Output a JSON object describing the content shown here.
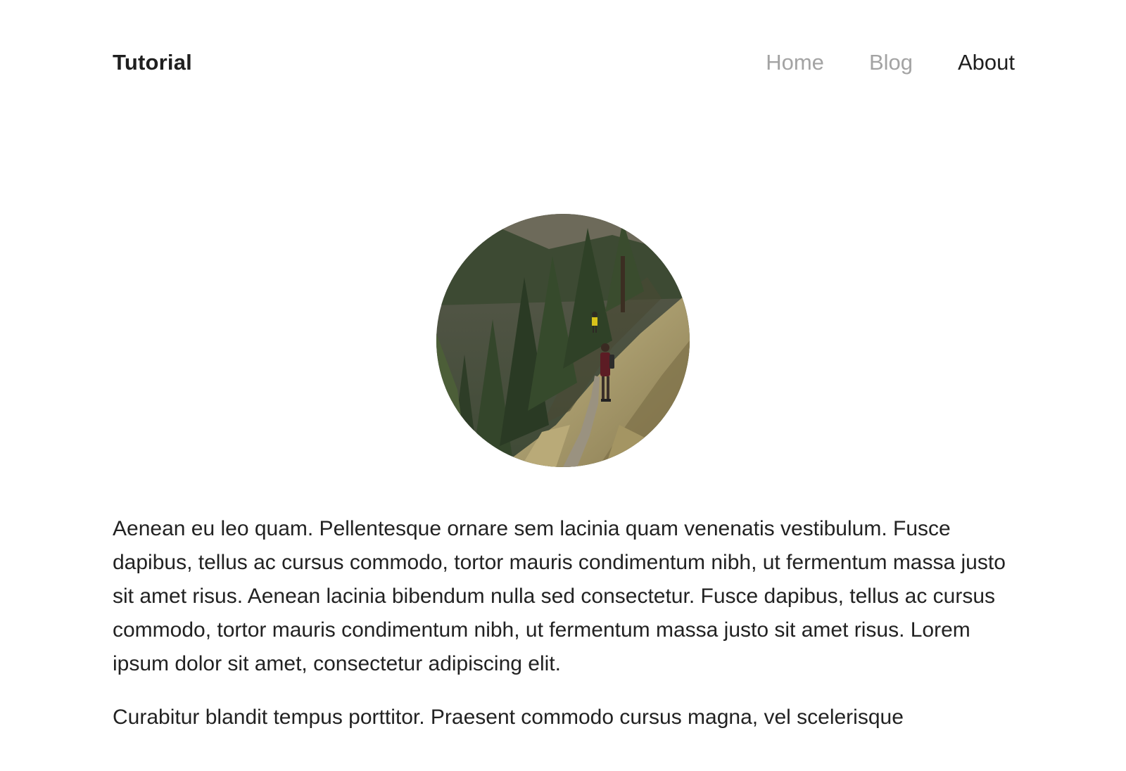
{
  "site": {
    "brand": "Tutorial"
  },
  "nav": {
    "items": [
      {
        "label": "Home",
        "active": false
      },
      {
        "label": "Blog",
        "active": false
      },
      {
        "label": "About",
        "active": true
      }
    ]
  },
  "hero": {
    "alt": "Hikers on a forest trail",
    "icon": "photo-avatar"
  },
  "content": {
    "paragraphs": [
      "Aenean eu leo quam. Pellentesque ornare sem lacinia quam venenatis vestibulum. Fusce dapibus, tellus ac cursus commodo, tortor mauris condimentum nibh, ut fermentum massa justo sit amet risus. Aenean lacinia bibendum nulla sed consectetur. Fusce dapibus, tellus ac cursus commodo, tortor mauris condimentum nibh, ut fermentum massa justo sit amet risus. Lorem ipsum dolor sit amet, consectetur adipiscing elit.",
      "Curabitur blandit tempus porttitor. Praesent commodo cursus magna, vel scelerisque"
    ]
  },
  "colors": {
    "text": "#222222",
    "nav_inactive": "#a3a3a3",
    "nav_active": "#1f1f1f",
    "background": "#ffffff"
  }
}
